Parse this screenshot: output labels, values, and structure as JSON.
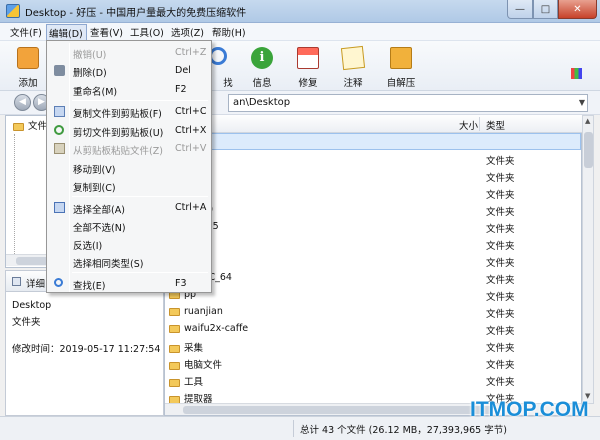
{
  "window": {
    "title": "Desktop - 好压 - 中国用户量最大的免费压缩软件",
    "min": "—",
    "max": "□",
    "close": "✕"
  },
  "menubar": {
    "items": [
      "文件(F)",
      "编辑(D)",
      "查看(V)",
      "工具(O)",
      "选项(Z)",
      "帮助(H)"
    ]
  },
  "toolbar": {
    "items": [
      {
        "label": "添加",
        "icon": "add-archive-icon"
      },
      {
        "label": "查找",
        "icon": "search-icon"
      },
      {
        "label": "信息",
        "icon": "info-icon"
      },
      {
        "label": "修复",
        "icon": "repair-icon"
      },
      {
        "label": "注释",
        "icon": "comment-icon"
      },
      {
        "label": "自解压",
        "icon": "sfx-icon"
      }
    ],
    "find_visible": "找",
    "add_visible": "添加"
  },
  "address": {
    "value": "an\\Desktop",
    "dropdown": "▼",
    "back": "◀",
    "forward": "▶"
  },
  "tree": {
    "header": "文件"
  },
  "details": {
    "tab": "详细",
    "name": "Desktop",
    "type": "文件夹",
    "modified": "修改时间：2019-05-17 11:27:54"
  },
  "filelist": {
    "columns": {
      "size": "大小",
      "type": "类型"
    },
    "rows": [
      {
        "name": "目录)",
        "type": "",
        "selected": true
      },
      {
        "name": "",
        "type": "文件夹"
      },
      {
        "name": "",
        "type": "文件夹"
      },
      {
        "name": "板",
        "type": "文件夹"
      },
      {
        "name": "per(2)",
        "type": "文件夹"
      },
      {
        "name": "P_2265",
        "type": "文件夹"
      },
      {
        "name": "out",
        "type": "文件夹"
      },
      {
        "name": "",
        "type": "文件夹"
      },
      {
        "name": "hopCC_64",
        "type": "文件夹"
      },
      {
        "name": "pp",
        "type": "文件夹"
      },
      {
        "name": "ruanjian",
        "type": "文件夹"
      },
      {
        "name": "waifu2x-caffe",
        "type": "文件夹"
      },
      {
        "name": "采集",
        "type": "文件夹"
      },
      {
        "name": "电脑文件",
        "type": "文件夹"
      },
      {
        "name": "工具",
        "type": "文件夹"
      },
      {
        "name": "提取器",
        "type": "文件夹"
      }
    ]
  },
  "status": {
    "text": "总计 43 个文件 (26.12 MB，27,393,965 字节)"
  },
  "watermark": "ITMOP.COM",
  "edit_menu": {
    "items": [
      {
        "label": "撤销(U)",
        "shortcut": "Ctrl+Z",
        "disabled": true,
        "icon": ""
      },
      {
        "label": "删除(D)",
        "shortcut": "Del",
        "disabled": false,
        "icon": "delete-icon"
      },
      {
        "label": "重命名(M)",
        "shortcut": "F2",
        "disabled": false,
        "icon": ""
      },
      {
        "label": "复制文件到剪贴板(F)",
        "shortcut": "Ctrl+C",
        "disabled": false,
        "icon": "copy-icon"
      },
      {
        "label": "剪切文件到剪贴板(U)",
        "shortcut": "Ctrl+X",
        "disabled": false,
        "icon": "cut-icon"
      },
      {
        "label": "从剪贴板粘贴文件(Z)",
        "shortcut": "Ctrl+V",
        "disabled": true,
        "icon": "paste-icon"
      },
      {
        "label": "移动到(V)",
        "shortcut": "",
        "disabled": false,
        "icon": ""
      },
      {
        "label": "复制到(C)",
        "shortcut": "",
        "disabled": false,
        "icon": ""
      },
      {
        "label": "选择全部(A)",
        "shortcut": "Ctrl+A",
        "disabled": false,
        "icon": "select-all-icon"
      },
      {
        "label": "全部不选(N)",
        "shortcut": "",
        "disabled": false,
        "icon": ""
      },
      {
        "label": "反选(I)",
        "shortcut": "",
        "disabled": false,
        "icon": ""
      },
      {
        "label": "选择相同类型(S)",
        "shortcut": "",
        "disabled": false,
        "icon": ""
      },
      {
        "label": "查找(E)",
        "shortcut": "F3",
        "disabled": false,
        "icon": "find-icon"
      }
    ]
  }
}
